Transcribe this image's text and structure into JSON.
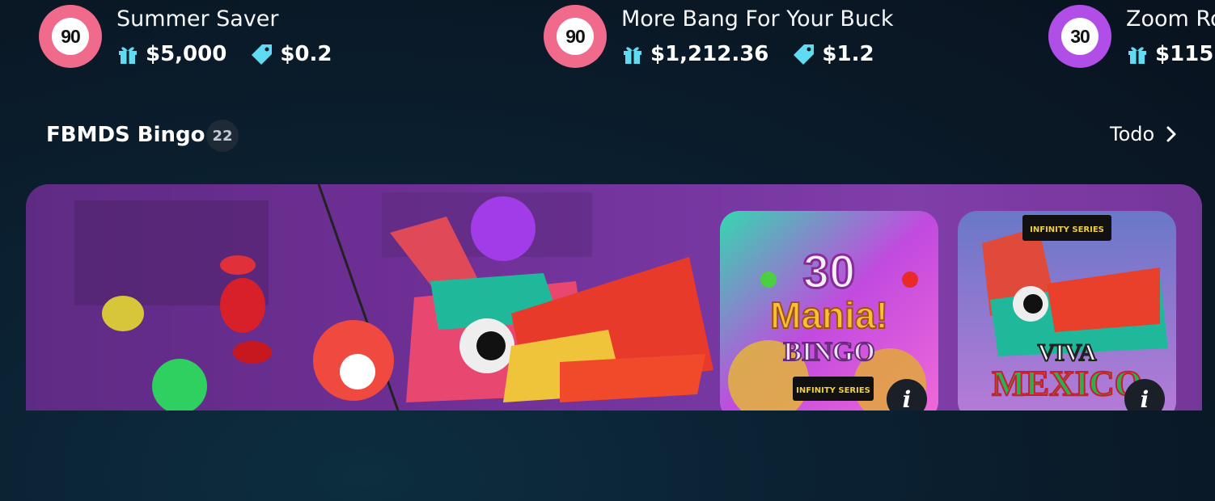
{
  "rooms": [
    {
      "ball_number": "90",
      "name": "Summer Saver",
      "prize": "$5,000",
      "ticket_price": "$0.2",
      "ball_color": "#f06a8c"
    },
    {
      "ball_number": "90",
      "name": "More Bang For Your Buck",
      "prize": "$1,212.36",
      "ticket_price": "$1.2",
      "ball_color": "#f06a8c"
    },
    {
      "ball_number": "30",
      "name": "Zoom Ro",
      "prize": "$115.",
      "ticket_price": "",
      "ball_color": "#b24ee8"
    }
  ],
  "icons": {
    "prize": "gift-icon",
    "price": "price-tag-icon",
    "accent": "#5fdcf2"
  },
  "section": {
    "title": "FBMDS Bingo",
    "count": "22",
    "see_all_label": "Todo"
  },
  "games": [
    {
      "name": "30 Mania! Bingo",
      "lines": [
        "30",
        "Mania!",
        "BINGO"
      ],
      "badge": "INFINITY SERIES"
    },
    {
      "name": "Viva Mexico",
      "lines": [
        "VIVA",
        "MEXICO"
      ],
      "badge": "INFINITY SERIES"
    }
  ],
  "info_label": "i"
}
